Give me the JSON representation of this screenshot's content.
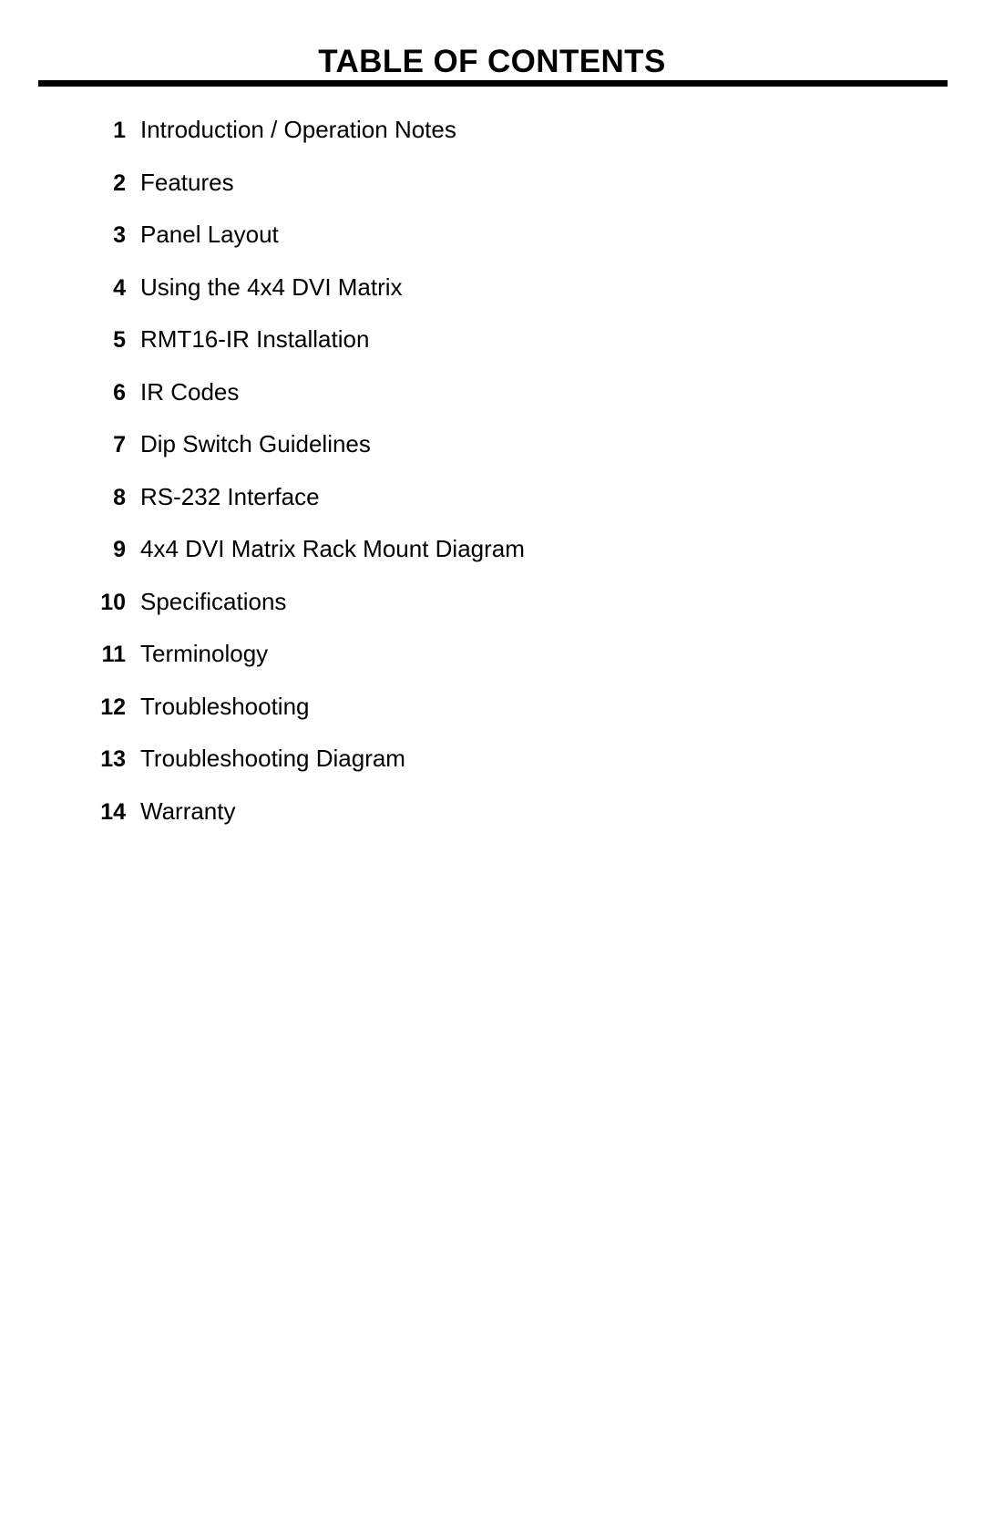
{
  "document": {
    "title": "TABLE OF CONTENTS",
    "background_color": "#ffffff",
    "text_color": "#000000",
    "rule_color": "#000000"
  },
  "toc": {
    "entries": [
      {
        "number": "1",
        "label": "Introduction / Operation Notes"
      },
      {
        "number": "2",
        "label": "Features"
      },
      {
        "number": "3",
        "label": "Panel Layout"
      },
      {
        "number": "4",
        "label": "Using the 4x4 DVI Matrix"
      },
      {
        "number": "5",
        "label": "RMT16-IR Installation"
      },
      {
        "number": "6",
        "label": "IR Codes"
      },
      {
        "number": "7",
        "label": "Dip Switch Guidelines"
      },
      {
        "number": "8",
        "label": "RS-232 Interface"
      },
      {
        "number": "9",
        "label": "4x4 DVI Matrix Rack Mount Diagram"
      },
      {
        "number": "10",
        "label": "Specifications"
      },
      {
        "number": "11",
        "label": "Terminology"
      },
      {
        "number": "12",
        "label": "Troubleshooting"
      },
      {
        "number": "13",
        "label": "Troubleshooting Diagram"
      },
      {
        "number": "14",
        "label": "Warranty"
      }
    ]
  }
}
